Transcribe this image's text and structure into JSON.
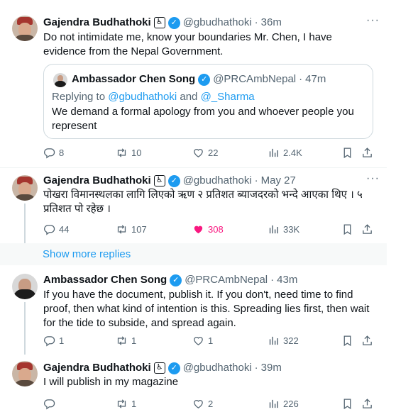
{
  "tweets": [
    {
      "name": "Gajendra Budhathoki",
      "a11y_icon": "wheelchair-accessibility-icon",
      "handle": "@gbudhathoki",
      "sep": "·",
      "time": "36m",
      "more": "···",
      "text": "Do not intimidate me, know your boundaries Mr. Chen, I have evidence from the Nepal Government.",
      "quote": {
        "name": "Ambassador Chen Song",
        "handle": "@PRCAmbNepal",
        "sep": "·",
        "time": "47m",
        "replying_prefix": "Replying to",
        "mention1": "@gbudhathoki",
        "and": "and",
        "mention2": "@_Sharma",
        "text": "We demand a formal apology from you and whoever people you represent"
      },
      "replies": "8",
      "reposts": "10",
      "likes": "22",
      "views": "2.4K"
    },
    {
      "name": "Gajendra Budhathoki",
      "handle": "@gbudhathoki",
      "sep": "·",
      "time": "May 27",
      "more": "···",
      "text": "पोखरा विमानस्थलका लागि लिएको ऋण २ प्रतिशत ब्याजदरको भन्दे आएका थिए । ५ प्रतिशत पो रहेछ ।",
      "replies": "44",
      "reposts": "107",
      "likes": "308",
      "views": "33K"
    },
    {
      "name": "Ambassador Chen Song",
      "handle": "@PRCAmbNepal",
      "sep": "·",
      "time": "43m",
      "text": "If you have the document, publish it. If you don't, need time to find proof, then what kind of intention is this. Spreading lies first, then wait for the tide to subside, and spread again.",
      "replies": "1",
      "reposts": "1",
      "likes": "1",
      "views": "322"
    },
    {
      "name": "Gajendra Budhathoki",
      "handle": "@gbudhathoki",
      "sep": "·",
      "time": "39m",
      "text": "I will publish in my magazine",
      "replies": "",
      "reposts": "1",
      "likes": "2",
      "views": "226"
    }
  ],
  "show_more_replies": "Show more replies",
  "colors": {
    "accent": "#1d9bf0",
    "like": "#f91880",
    "muted": "#536471",
    "verified": "#1d9bf0"
  }
}
